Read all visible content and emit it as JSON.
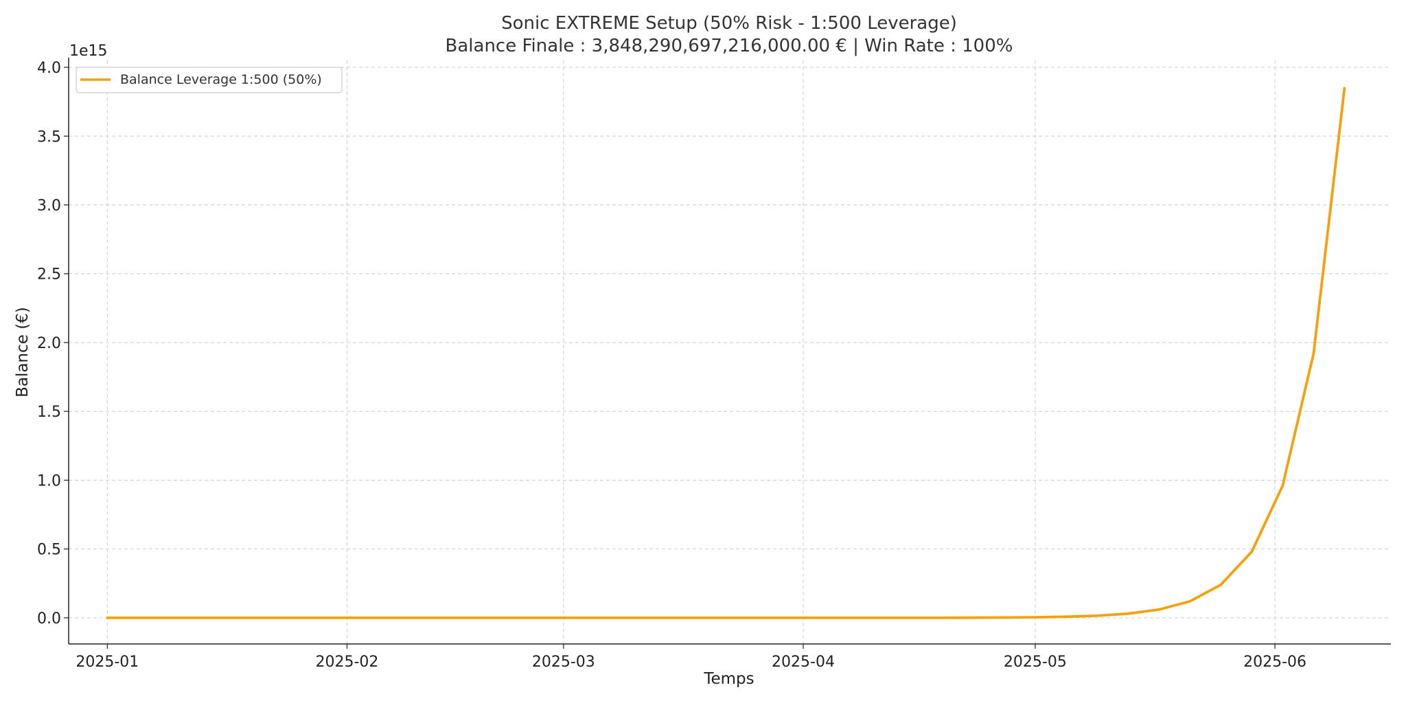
{
  "chart_data": {
    "type": "line",
    "title": "Sonic EXTREME Setup (50% Risk - 1:500 Leverage)",
    "subtitle": "Balance Finale : 3,848,290,697,216,000.00 € | Win Rate : 100%",
    "xlabel": "Temps",
    "ylabel": "Balance (€)",
    "y_offset_label": "1e15",
    "y_scale": 1000000000000000.0,
    "xlim": [
      "2024-12-27",
      "2025-06-16"
    ],
    "ylim": [
      -0.19,
      4.05
    ],
    "x_ticks": [
      {
        "date": "2025-01-01",
        "label": "2025-01"
      },
      {
        "date": "2025-02-01",
        "label": "2025-02"
      },
      {
        "date": "2025-03-01",
        "label": "2025-03"
      },
      {
        "date": "2025-04-01",
        "label": "2025-04"
      },
      {
        "date": "2025-05-01",
        "label": "2025-05"
      },
      {
        "date": "2025-06-01",
        "label": "2025-06"
      }
    ],
    "y_ticks": [
      "0.0",
      "0.5",
      "1.0",
      "1.5",
      "2.0",
      "2.5",
      "3.0",
      "3.5",
      "4.0"
    ],
    "grid": true,
    "legend_position": "top-left",
    "series": [
      {
        "name": "Balance Leverage 1:500 (50%)",
        "color": "#f5a10f",
        "x": [
          "2025-01-01",
          "2025-01-05",
          "2025-01-09",
          "2025-01-13",
          "2025-01-17",
          "2025-01-21",
          "2025-01-25",
          "2025-01-29",
          "2025-02-02",
          "2025-02-06",
          "2025-02-10",
          "2025-02-14",
          "2025-02-18",
          "2025-02-22",
          "2025-02-26",
          "2025-03-02",
          "2025-03-06",
          "2025-03-10",
          "2025-03-14",
          "2025-03-18",
          "2025-03-22",
          "2025-03-26",
          "2025-03-30",
          "2025-04-03",
          "2025-04-07",
          "2025-04-11",
          "2025-04-15",
          "2025-04-19",
          "2025-04-23",
          "2025-04-27",
          "2025-05-01",
          "2025-05-05",
          "2025-05-09",
          "2025-05-13",
          "2025-05-17",
          "2025-05-21",
          "2025-05-25",
          "2025-05-29",
          "2025-06-02",
          "2025-06-06",
          "2025-06-10"
        ],
        "y": [
          0,
          0,
          0,
          0,
          0,
          0,
          0,
          0,
          0,
          0,
          0,
          0,
          0,
          0,
          0,
          0,
          0,
          0,
          0,
          0,
          0,
          0,
          0,
          0,
          0,
          0,
          0,
          0,
          0.001,
          0.002,
          0.004,
          0.008,
          0.015,
          0.03,
          0.06,
          0.12,
          0.24,
          0.48,
          0.96,
          1.92,
          3.848
        ]
      }
    ]
  }
}
